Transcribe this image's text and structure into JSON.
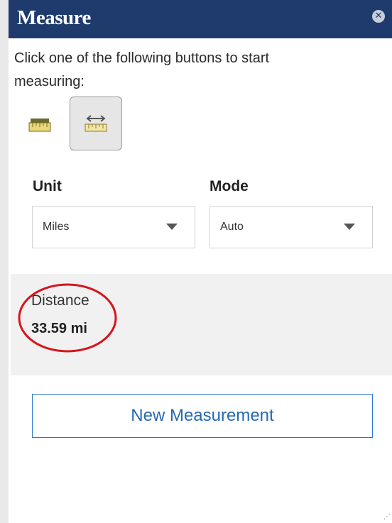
{
  "header": {
    "title": "Measure",
    "close_icon": "close-icon"
  },
  "instructions": "Click one of the following buttons to start measuring:",
  "tools": [
    {
      "name": "area",
      "icon": "area-ruler-icon",
      "active": false
    },
    {
      "name": "distance",
      "icon": "distance-ruler-icon",
      "active": true
    }
  ],
  "unit": {
    "label": "Unit",
    "value": "Miles"
  },
  "mode": {
    "label": "Mode",
    "value": "Auto"
  },
  "result": {
    "label": "Distance",
    "value": "33.59 mi"
  },
  "new_measurement_label": "New Measurement",
  "colors": {
    "header_bg": "#1f3a6c",
    "accent_blue": "#2b79c9",
    "highlight_red": "#d7141c",
    "result_bg": "#f1f1f1"
  }
}
